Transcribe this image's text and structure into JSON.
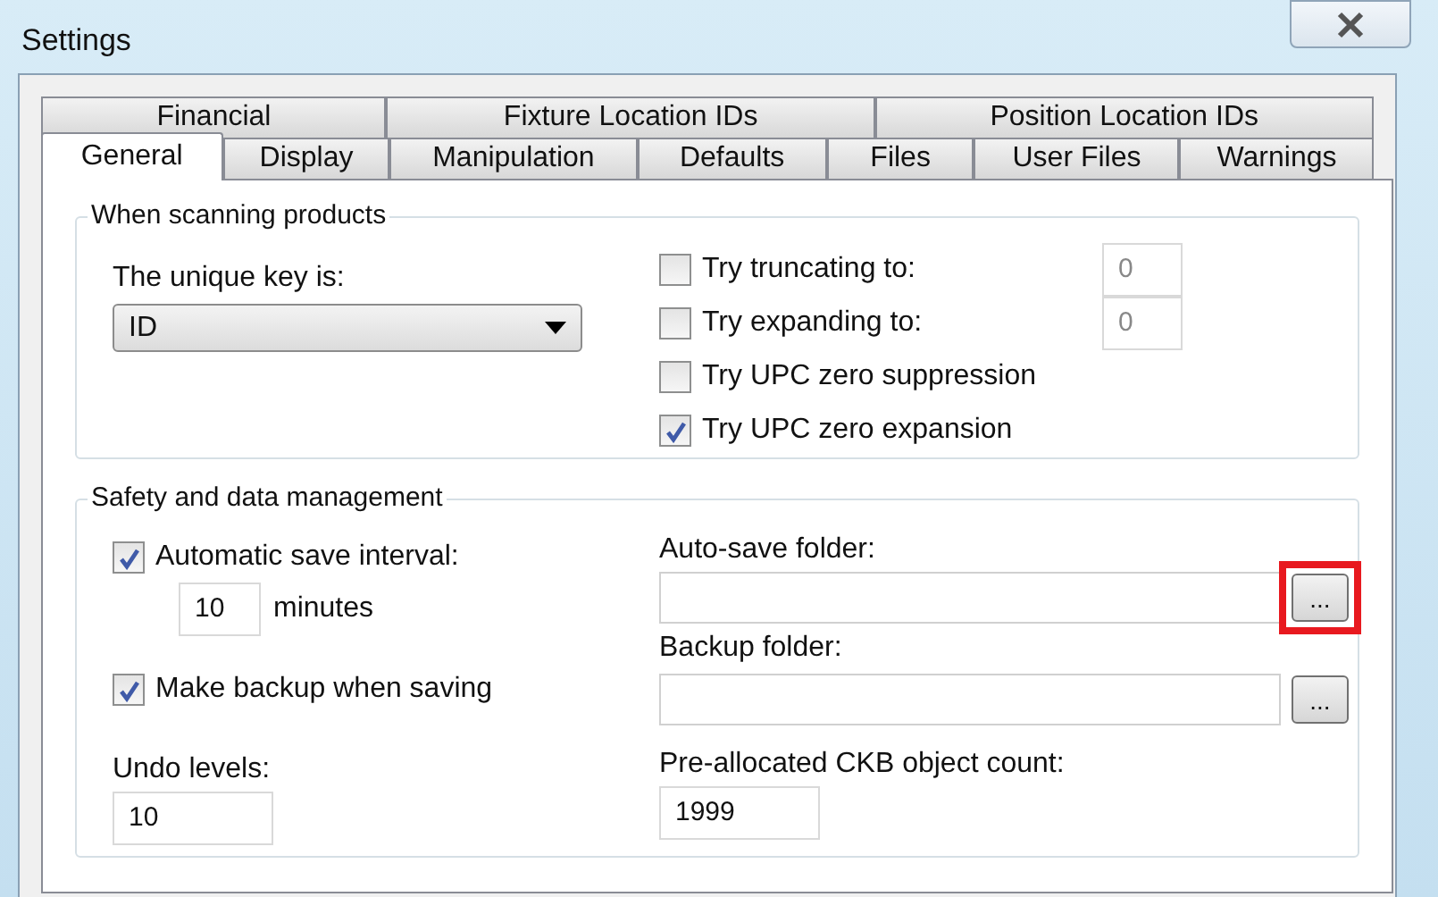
{
  "window": {
    "title": "Settings"
  },
  "tab_rows": [
    [
      {
        "label": "Financial",
        "selected": false
      },
      {
        "label": "Fixture Location IDs",
        "selected": false
      },
      {
        "label": "Position Location IDs",
        "selected": false
      }
    ],
    [
      {
        "label": "General",
        "selected": true
      },
      {
        "label": "Display",
        "selected": false
      },
      {
        "label": "Manipulation",
        "selected": false
      },
      {
        "label": "Defaults",
        "selected": false
      },
      {
        "label": "Files",
        "selected": false
      },
      {
        "label": "User Files",
        "selected": false
      },
      {
        "label": "Warnings",
        "selected": false
      }
    ]
  ],
  "scanning": {
    "title": "When scanning products",
    "key_label": "The unique key is:",
    "key_value": "ID",
    "options": [
      {
        "label": "Try truncating to:",
        "checked": false,
        "value": "0"
      },
      {
        "label": "Try expanding to:",
        "checked": false,
        "value": "0"
      },
      {
        "label": "Try UPC zero suppression",
        "checked": false
      },
      {
        "label": "Try UPC zero expansion",
        "checked": true
      }
    ]
  },
  "safety": {
    "title": "Safety and data management",
    "autosave": {
      "label": "Automatic save interval:",
      "checked": true,
      "value": "10",
      "unit": "minutes"
    },
    "backup": {
      "label": "Make backup when saving",
      "checked": true
    },
    "undo": {
      "label": "Undo levels:",
      "value": "10"
    },
    "folders": [
      {
        "label": "Auto-save folder:",
        "button": "...",
        "highlighted": true
      },
      {
        "label": "Backup folder:",
        "button": "...",
        "highlighted": false
      }
    ],
    "ckb": {
      "label": "Pre-allocated CKB object count:",
      "value": "1999"
    }
  }
}
